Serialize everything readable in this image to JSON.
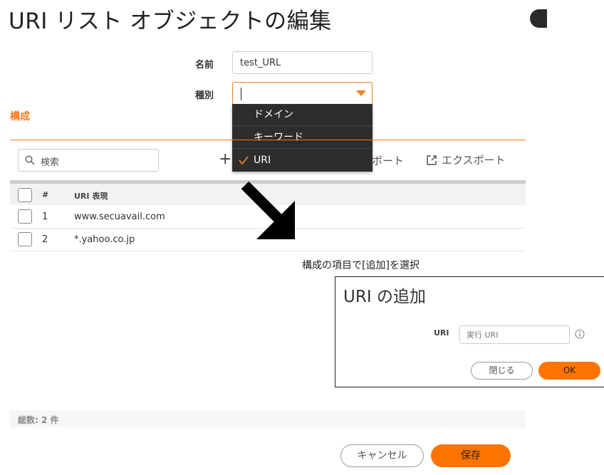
{
  "header": {
    "title": "URI リスト オブジェクトの編集"
  },
  "form": {
    "name_label": "名前",
    "name_value": "test_URL",
    "type_label": "種別",
    "type_value": ""
  },
  "type_dropdown": {
    "options": [
      {
        "label": "ドメイン",
        "selected": false
      },
      {
        "label": "キーワード",
        "selected": false
      },
      {
        "label": "URI",
        "selected": true
      }
    ]
  },
  "config": {
    "heading": "構成"
  },
  "toolbar": {
    "search_placeholder": "検索",
    "add_label": "+",
    "import_label": "ポート",
    "export_label": "エクスポート"
  },
  "table": {
    "columns": [
      "#",
      "URI 表現"
    ],
    "rows": [
      {
        "num": "1",
        "uri": "www.secuavail.com"
      },
      {
        "num": "2",
        "uri": "*.yahoo.co.jp"
      }
    ]
  },
  "annotation": {
    "instruction": "構成の項目で[追加]を選択"
  },
  "add_dialog": {
    "title": "URI の追加",
    "uri_label": "URI",
    "uri_placeholder": "実行 URI",
    "close_label": "閉じる",
    "ok_label": "OK"
  },
  "footer": {
    "total": "総数: 2 件"
  },
  "actions": {
    "cancel_label": "キャンセル",
    "save_label": "保存"
  },
  "colors": {
    "accent": "#ff7300",
    "heading_orange": "#f07b1a",
    "dropdown_bg": "#2d2d2d"
  }
}
